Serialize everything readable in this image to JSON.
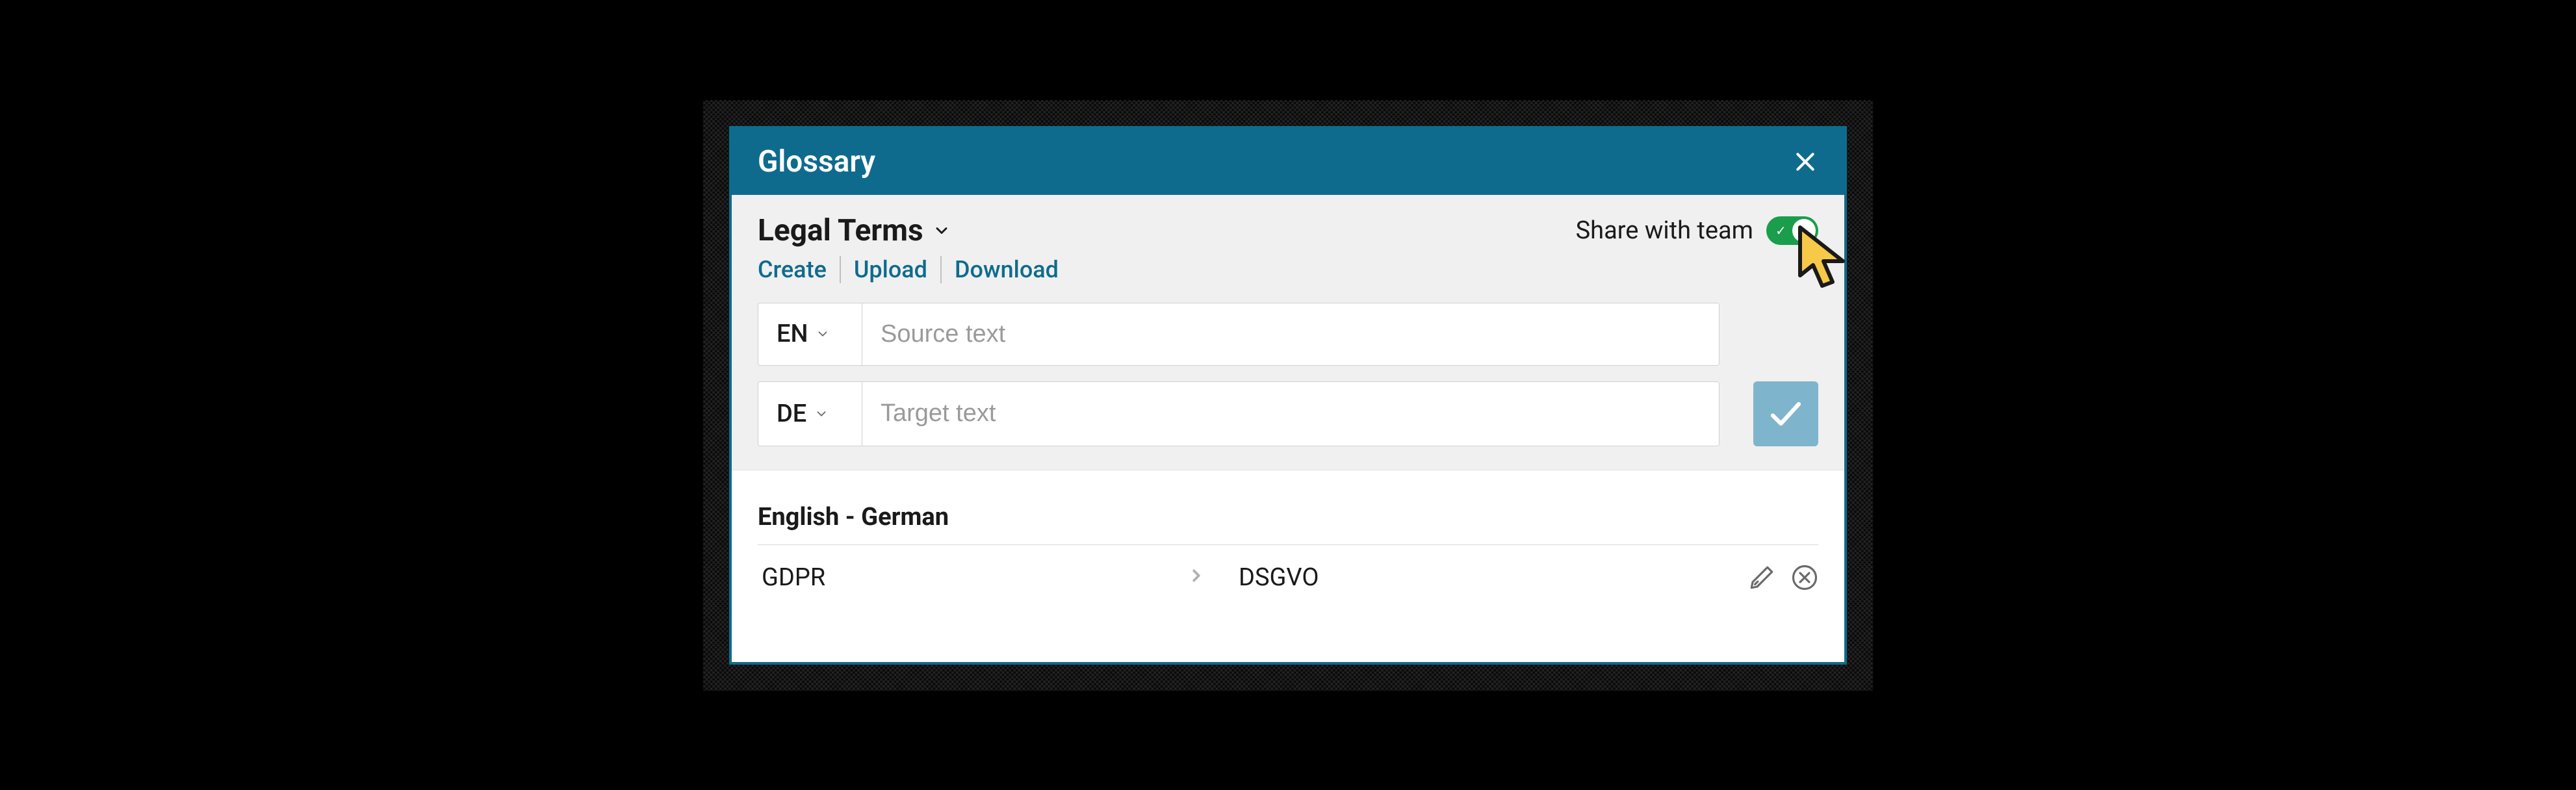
{
  "modal": {
    "title": "Glossary"
  },
  "glossary": {
    "name": "Legal Terms"
  },
  "share": {
    "label": "Share with team",
    "enabled": true
  },
  "actions": {
    "create": "Create",
    "upload": "Upload",
    "download": "Download"
  },
  "inputs": {
    "source_lang": "EN",
    "source_placeholder": "Source text",
    "target_lang": "DE",
    "target_placeholder": "Target text"
  },
  "entries": {
    "header": "English  -  German",
    "rows": [
      {
        "source": "GDPR",
        "target": "DSGVO"
      }
    ]
  }
}
